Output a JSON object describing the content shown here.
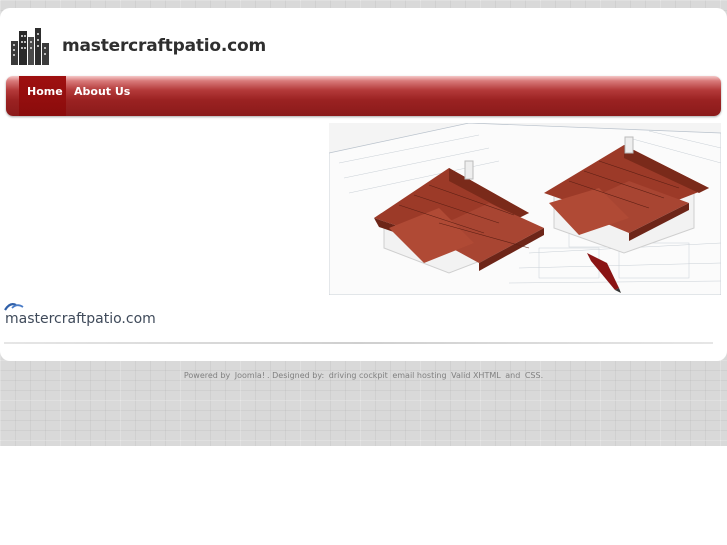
{
  "site": {
    "title": "mastercraftpatio.com",
    "footer_name": "mastercraftpatio.com"
  },
  "nav": {
    "items": [
      {
        "label": "Home",
        "active": true
      },
      {
        "label": "About Us",
        "active": false
      }
    ]
  },
  "footer": {
    "powered_by": "Powered by",
    "joomla": "Joomla!",
    "designed_by": ". Designed by:",
    "designer_link": "driving cockpit",
    "hosting_link": "email hosting",
    "xhtml_link": "Valid XHTML",
    "and": "and",
    "css_link": "CSS."
  },
  "icons": {
    "logo": "city-buildings-icon",
    "small_logo": "swoosh-logo-icon",
    "hero": "house-blueprint-image"
  },
  "colors": {
    "nav_red": "#9b2222",
    "active_tab": "#8a0c0c",
    "title_text": "#2f2f2f",
    "footer_text": "#808080"
  }
}
